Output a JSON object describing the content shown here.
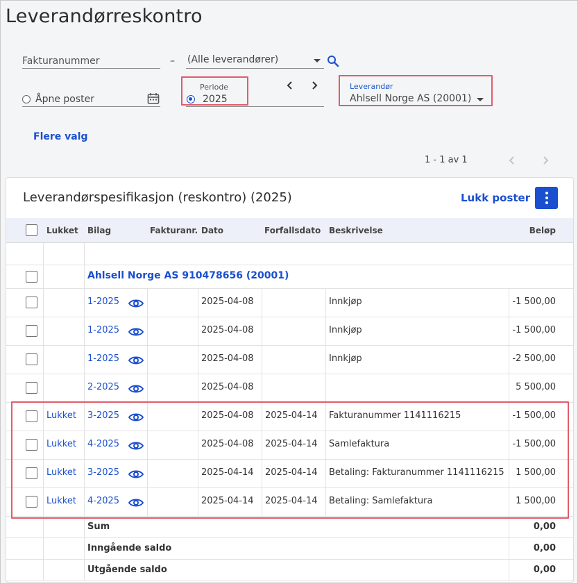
{
  "page": {
    "title": "Leverandørreskontro"
  },
  "filters": {
    "fakturanummer_placeholder": "Fakturanummer",
    "dash": "–",
    "leverandor_select": "(Alle leverandører)",
    "apne_poster_label": "Åpne poster",
    "periode_label": "Periode",
    "periode_value": "2025",
    "leverandor_label": "Leverandør",
    "leverandor_value": "Ahlsell Norge AS (20001)",
    "flere_valg": "Flere valg"
  },
  "pagination": {
    "text": "1 - 1 av 1"
  },
  "card": {
    "title": "Leverandørspesifikasjon (reskontro) (2025)",
    "lukk_poster": "Lukk poster"
  },
  "table": {
    "headers": {
      "lukket": "Lukket",
      "bilag": "Bilag",
      "fakturanr": "Fakturanr.",
      "dato": "Dato",
      "forfallsdato": "Forfallsdato",
      "beskrivelse": "Beskrivelse",
      "belop": "Beløp"
    },
    "group_title": "Ahlsell Norge AS 910478656 (20001)",
    "rows": [
      {
        "lukket": "",
        "bilag": "1-2025",
        "fakturanr": "",
        "dato": "2025-04-08",
        "forfallsdato": "",
        "beskrivelse": "Innkjøp",
        "belop": "-1 500,00"
      },
      {
        "lukket": "",
        "bilag": "1-2025",
        "fakturanr": "",
        "dato": "2025-04-08",
        "forfallsdato": "",
        "beskrivelse": "Innkjøp",
        "belop": "-1 500,00"
      },
      {
        "lukket": "",
        "bilag": "1-2025",
        "fakturanr": "",
        "dato": "2025-04-08",
        "forfallsdato": "",
        "beskrivelse": "Innkjøp",
        "belop": "-2 500,00"
      },
      {
        "lukket": "",
        "bilag": "2-2025",
        "fakturanr": "",
        "dato": "2025-04-08",
        "forfallsdato": "",
        "beskrivelse": "",
        "belop": "5 500,00"
      },
      {
        "lukket": "Lukket",
        "bilag": "3-2025",
        "fakturanr": "",
        "dato": "2025-04-08",
        "forfallsdato": "2025-04-14",
        "beskrivelse": "Fakturanummer 1141116215",
        "belop": "-1 500,00"
      },
      {
        "lukket": "Lukket",
        "bilag": "4-2025",
        "fakturanr": "",
        "dato": "2025-04-08",
        "forfallsdato": "2025-04-14",
        "beskrivelse": "Samlefaktura",
        "belop": "-1 500,00"
      },
      {
        "lukket": "Lukket",
        "bilag": "3-2025",
        "fakturanr": "",
        "dato": "2025-04-14",
        "forfallsdato": "2025-04-14",
        "beskrivelse": "Betaling: Fakturanummer 1141116215",
        "belop": "1 500,00"
      },
      {
        "lukket": "Lukket",
        "bilag": "4-2025",
        "fakturanr": "",
        "dato": "2025-04-14",
        "forfallsdato": "2025-04-14",
        "beskrivelse": "Betaling: Samlefaktura",
        "belop": "1 500,00"
      }
    ],
    "summary": [
      {
        "label": "Sum",
        "value": "0,00"
      },
      {
        "label": "Inngående saldo",
        "value": "0,00"
      },
      {
        "label": "Utgående saldo",
        "value": "0,00"
      }
    ]
  },
  "icons": {
    "search": "search-icon",
    "calendar": "calendar-icon",
    "prev": "chevron-left-icon",
    "next": "chevron-right-icon",
    "eye": "eye-icon",
    "more": "more-vertical-icon"
  },
  "colors": {
    "accent": "#1a4fcf",
    "highlight": "#e05c6a"
  }
}
